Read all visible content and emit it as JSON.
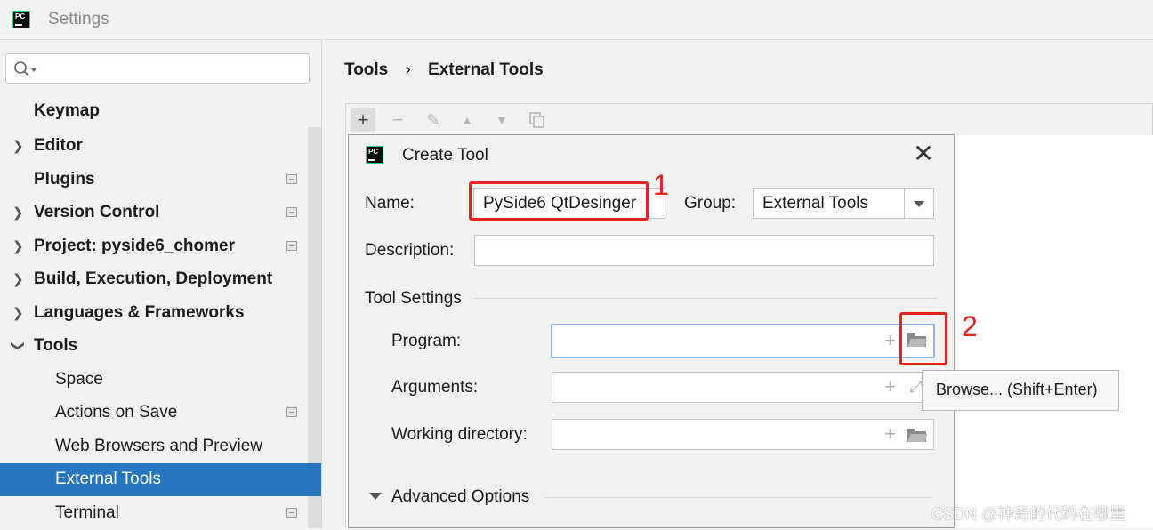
{
  "window": {
    "title": "Settings",
    "app_icon": "pycharm-logo-icon",
    "app_icon_text": "PC"
  },
  "sidebar": {
    "search": {
      "placeholder": "",
      "icon": "search-icon"
    },
    "items": [
      {
        "label": "Keymap",
        "expandable": false,
        "settings_icon": false
      },
      {
        "label": "Editor",
        "expandable": true,
        "settings_icon": false
      },
      {
        "label": "Plugins",
        "expandable": false,
        "settings_icon": true
      },
      {
        "label": "Version Control",
        "expandable": true,
        "settings_icon": true
      },
      {
        "label": "Project: pyside6_chomer",
        "expandable": true,
        "settings_icon": true
      },
      {
        "label": "Build, Execution, Deployment",
        "expandable": true,
        "settings_icon": false
      },
      {
        "label": "Languages & Frameworks",
        "expandable": true,
        "settings_icon": false
      },
      {
        "label": "Tools",
        "expandable": true,
        "expanded": true,
        "settings_icon": false
      },
      {
        "label": "Space",
        "settings_icon": false
      },
      {
        "label": "Actions on Save",
        "settings_icon": true
      },
      {
        "label": "Web Browsers and Preview",
        "settings_icon": false
      },
      {
        "label": "External Tools",
        "selected": true,
        "settings_icon": false
      },
      {
        "label": "Terminal",
        "settings_icon": true
      }
    ]
  },
  "main": {
    "breadcrumb": [
      "Tools",
      "External Tools"
    ],
    "breadcrumb_separator": "›",
    "toolbar": [
      "add-icon",
      "remove-icon",
      "edit-icon",
      "move-up-icon",
      "move-down-icon",
      "copy-icon"
    ]
  },
  "dialog": {
    "title": "Create Tool",
    "close_glyph": "✕",
    "name_label": "Name:",
    "name_value": "PySide6 QtDesinger",
    "group_label": "Group:",
    "group_value": "External Tools",
    "description_label": "Description:",
    "description_value": "",
    "tool_settings_label": "Tool Settings",
    "program_label": "Program:",
    "program_value": "",
    "arguments_label": "Arguments:",
    "arguments_value": "",
    "working_dir_label": "Working directory:",
    "working_dir_value": "",
    "advanced_label": "Advanced Options"
  },
  "tooltip": {
    "text": "Browse... (Shift+Enter)"
  },
  "annotations": {
    "step1": "1",
    "step2": "2",
    "color": "#e8221d"
  },
  "watermark": "CSDN @神奇的代码在哪里",
  "colors": {
    "selection": "#2675bf",
    "focus": "#8bb4e3"
  }
}
